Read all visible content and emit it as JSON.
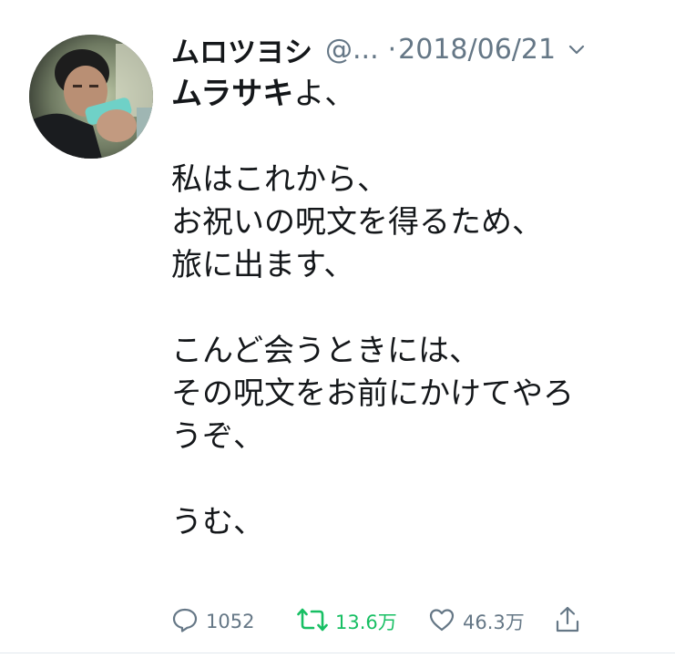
{
  "tweet": {
    "author": {
      "display_name": "ムロツヨシ",
      "handle": "@...",
      "avatar_icon": "user-avatar"
    },
    "separator": "·",
    "date": "2018/06/21",
    "menu_icon": "chevron-down-icon",
    "text": {
      "first_bold": "ムラサキ",
      "first_rest": "よ、",
      "lines": [
        "",
        "私はこれから、",
        "お祝いの呪文を得るため、",
        "旅に出ます、",
        "",
        "こんど会うときには、",
        "その呪文をお前にかけてやろ",
        "うぞ、",
        "",
        "うむ、"
      ]
    },
    "actions": {
      "reply": {
        "icon": "reply-icon",
        "count": "1052"
      },
      "retweet": {
        "icon": "retweet-icon",
        "count": "13.6万",
        "color": "#17bf63"
      },
      "like": {
        "icon": "heart-icon",
        "count": "46.3万"
      },
      "share": {
        "icon": "share-icon"
      }
    },
    "colors": {
      "text": "#14171a",
      "muted": "#657786",
      "retweeted": "#17bf63"
    }
  }
}
